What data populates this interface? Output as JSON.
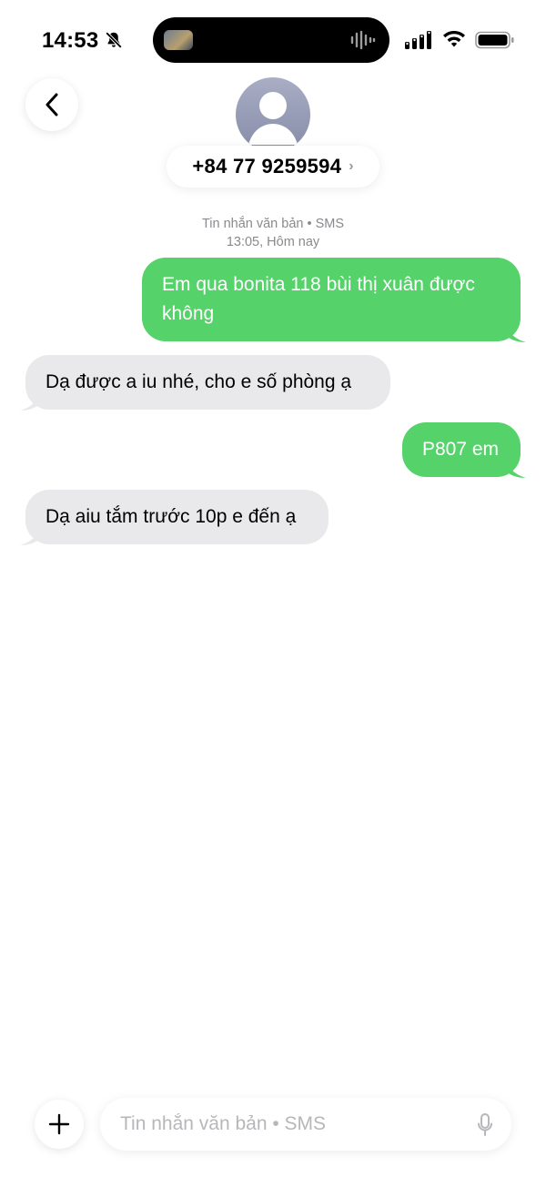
{
  "status_bar": {
    "time": "14:53"
  },
  "header": {
    "contact_number": "+84 77 9259594",
    "chevron": "›"
  },
  "conversation_meta": {
    "channel": "Tin nhắn văn bản • SMS",
    "timestamp": "13:05, Hôm nay"
  },
  "messages": [
    {
      "direction": "sent",
      "text": "Em qua bonita 118 bùi thị xuân được không"
    },
    {
      "direction": "received",
      "text": "Dạ được a iu nhé, cho e số phòng ạ"
    },
    {
      "direction": "sent",
      "text": "P807 em"
    },
    {
      "direction": "received",
      "text": "Dạ aiu tắm trước 10p e đến ạ"
    }
  ],
  "composer": {
    "placeholder": "Tin nhắn văn bản • SMS",
    "value": ""
  },
  "colors": {
    "sent_bubble": "#55d26a",
    "received_bubble": "#e9e9eb",
    "secondary_text": "#8a8a8e"
  },
  "icons": [
    "bell-slash-icon",
    "audio-waveform-icon",
    "cellular-signal-icon",
    "wifi-icon",
    "battery-icon",
    "back-chevron-icon",
    "person-icon",
    "plus-icon",
    "microphone-icon"
  ]
}
